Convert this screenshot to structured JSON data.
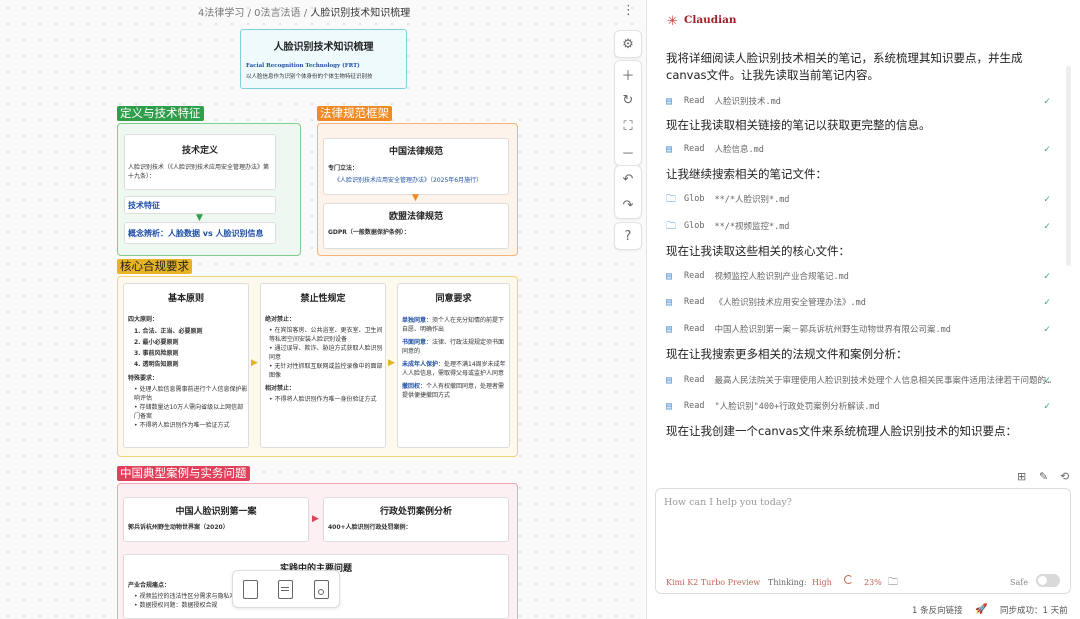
{
  "breadcrumb": {
    "part1": "4法律学习",
    "sep": "/",
    "part2": "0法言法语",
    "part3": "人脸识别技术知识梳理"
  },
  "canvas": {
    "root": {
      "title": "人脸识别技术知识梳理",
      "subtitle": "Facial Recognition Technology (FRT)",
      "desc": "以人脸信息作为识别个体身份的个体生物特征识别技"
    },
    "groups": {
      "definition": {
        "label": "定义与技术特征",
        "color": "#2e9e4a",
        "tech_def_title": "技术定义",
        "tech_def_text": "人脸识别技术（《人脸识别技术应用安全管理办法》第十九条）：",
        "tech_feature": "技术特征",
        "concept": "概念辨析：人脸数据 vs 人脸识别信息"
      },
      "legal": {
        "label": "法律规范框架",
        "color": "#f08a24",
        "china_title": "中国法律规范",
        "china_sub": "专门立法：",
        "china_item": "《人脸识别技术应用安全管理办法》（2025年6月施行）",
        "eu_title": "欧盟法律规范",
        "eu_text": "GDPR（一般数据保护条例）："
      },
      "compliance": {
        "label": "核心合规要求",
        "color": "#e6b325",
        "basic_title": "基本原则",
        "basic_sub": "四大原则：",
        "basic_items": [
          "合法、正当、必要原则",
          "最小必要原则",
          "事前风险原则",
          "透明告知原则"
        ],
        "basic_special": "特殊要求：",
        "basic_special_items": [
          "处理人脸信息需事前进行个人信息保护影响评估",
          "存储数量达10万人需向省级以上网信部门备案",
          "不得将人脸识别作为唯一验证方式"
        ],
        "prohibit_title": "禁止性规定",
        "prohibit_sub": "绝对禁止：",
        "prohibit_items": [
          "在宾馆客房、公共浴室、更衣室、卫生间等私密空间安装人脸识别设备",
          "通过误导、欺诈、胁迫方式获取人脸识别同意",
          "无针对性抓取互联网或监控录像中的面部图像"
        ],
        "prohibit_sub2": "相对禁止：",
        "prohibit_items2": [
          "不得将人脸识别作为唯一身份验证方式"
        ],
        "consent_title": "同意要求",
        "consent_items": [
          {
            "k": "单独同意",
            "v": "：须个人在充分知情的前提下自愿、明确作出"
          },
          {
            "k": "书面同意",
            "v": "：法律、行政法规规定须书面同意的"
          },
          {
            "k": "未成年人保护",
            "v": "：处理不满14周岁未成年人人脸信息，需取得父母或监护人同意"
          },
          {
            "k": "撤回权",
            "v": "：个人有权撤回同意，处理者需提供便捷撤回方式"
          }
        ]
      },
      "cases": {
        "label": "中国典型案例与实务问题",
        "color": "#e0405a",
        "case1_title": "中国人脸识别第一案",
        "case1_text": "郭兵诉杭州野生动物世界案（2020）",
        "case2_title": "行政处罚案例分析",
        "case2_text": "400+人脸识别行政处罚案例：",
        "practice_title": "实践中的主要问题",
        "practice_sub": "产业合规痛点：",
        "practice_items": [
          "视频监控的违法性区分需求与隐私冲突",
          "数据授权问题：数据授权合规"
        ]
      }
    }
  },
  "assistant": {
    "brand": "Claudian",
    "messages": [
      {
        "type": "text",
        "text": "我将详细阅读人脸识别技术相关的笔记，系统梳理其知识要点，并生成canvas文件。让我先读取当前笔记内容。"
      },
      {
        "type": "tool",
        "name": "Read",
        "target": "人脸识别技术.md"
      },
      {
        "type": "text",
        "text": "现在让我读取相关链接的笔记以获取更完整的信息。"
      },
      {
        "type": "tool",
        "name": "Read",
        "target": "人脸信息.md"
      },
      {
        "type": "text",
        "text": "让我继续搜索相关的笔记文件："
      },
      {
        "type": "tool",
        "name": "Glob",
        "target": "**/*人脸识别*.md"
      },
      {
        "type": "tool",
        "name": "Glob",
        "target": "**/*视频监控*.md"
      },
      {
        "type": "text",
        "text": "现在让我读取这些相关的核心文件："
      },
      {
        "type": "tool",
        "name": "Read",
        "target": "视频监控人脸识别产业合规笔记.md"
      },
      {
        "type": "tool",
        "name": "Read",
        "target": "《人脸识别技术应用安全管理办法》.md"
      },
      {
        "type": "tool",
        "name": "Read",
        "target": "中国人脸识别第一案－郭兵诉杭州野生动物世界有限公司案.md"
      },
      {
        "type": "text",
        "text": "现在让我搜索更多相关的法规文件和案例分析："
      },
      {
        "type": "tool",
        "name": "Read",
        "target": "最高人民法院关于审理使用人脸识别技术处理个人信息相关民事案件适用法律若干问题的规定.md"
      },
      {
        "type": "tool",
        "name": "Read",
        "target": "\"人脸识别\"400+行政处罚案例分析解读.md"
      },
      {
        "type": "text",
        "text": "现在让我创建一个canvas文件来系统梳理人脸识别技术的知识要点："
      }
    ],
    "input_placeholder": "How can I help you today?",
    "model": "Kimi K2 Turbo Preview",
    "thinking_label": "Thinking:",
    "thinking_value": "High",
    "context_percent": "23%",
    "safe_label": "Safe"
  },
  "statusbar": {
    "backlinks": "1 条反向链接",
    "sync": "同步成功：1 天前"
  }
}
